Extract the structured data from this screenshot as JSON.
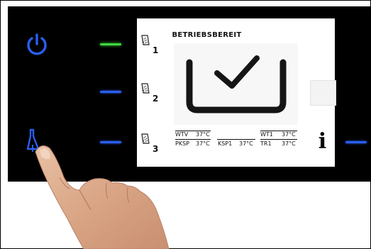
{
  "display": {
    "status_title": "BETRIEBSBEREIT",
    "status_icon": "checkmark-tray-icon"
  },
  "shower_buttons": [
    {
      "number": "1",
      "icon": "shower-icon",
      "led_color": "#3dd93d",
      "active": true
    },
    {
      "number": "2",
      "icon": "shower-icon",
      "led_color": "#2a5ff0",
      "active": false
    },
    {
      "number": "3",
      "icon": "shower-icon",
      "led_color": "#2a5ff0",
      "active": false
    }
  ],
  "left_buttons": {
    "power_icon": "power-icon",
    "thermal_disinfection_icon": "hand-shower-icon"
  },
  "temperatures": {
    "wtv_label": "WTV",
    "wtv_value": "37°C",
    "wt1_label": "WT1",
    "wt1_value": "37°C",
    "pksp_label": "PKSP",
    "pksp_value": "37°C",
    "ksp1_label": "KSP1",
    "ksp1_value": "37°C",
    "tr1_label": "TR1",
    "tr1_value": "37°C"
  },
  "info_button": {
    "label": "i",
    "led_color": "#2a5ff0"
  },
  "colors": {
    "panel": "#000000",
    "accent_blue": "#2a5ff0",
    "status_green": "#3dd93d"
  }
}
